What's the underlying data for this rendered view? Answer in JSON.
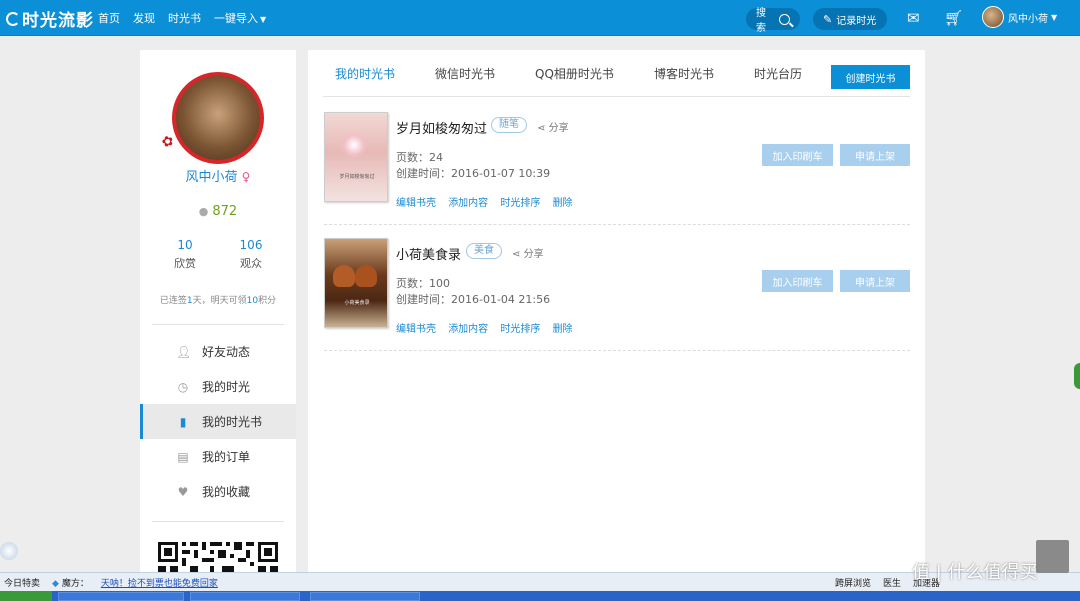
{
  "header": {
    "logo": "时光流影",
    "nav": [
      {
        "label": "首页"
      },
      {
        "label": "发现"
      },
      {
        "label": "时光书"
      },
      {
        "label": "一键导入"
      }
    ],
    "search_label": "搜索",
    "record_label": "记录时光",
    "username": "风中小荷"
  },
  "profile": {
    "name": "风中小荷",
    "points": "872",
    "appreciate_count": "10",
    "appreciate_label": "欣赏",
    "viewers_count": "106",
    "viewers_label": "观众",
    "signin_prefix": "已连签",
    "signin_days": "1",
    "signin_mid": "天，明天可领",
    "signin_points": "10",
    "signin_suffix": "积分"
  },
  "sidebar": {
    "items": [
      {
        "label": "好友动态",
        "icon": "user-icon"
      },
      {
        "label": "我的时光",
        "icon": "clock-icon"
      },
      {
        "label": "我的时光书",
        "icon": "book-icon"
      },
      {
        "label": "我的订单",
        "icon": "document-icon"
      },
      {
        "label": "我的收藏",
        "icon": "heart-icon"
      }
    ],
    "active_index": 2
  },
  "tabs": [
    {
      "label": "我的时光书"
    },
    {
      "label": "微信时光书"
    },
    {
      "label": "QQ相册时光书"
    },
    {
      "label": "博客时光书"
    },
    {
      "label": "时光台历"
    }
  ],
  "create_button": "创建时光书",
  "books": [
    {
      "title": "岁月如梭匆匆过",
      "tag": "随笔",
      "share": "分享",
      "pages": "页数：24",
      "created": "创建时间：2016-01-07 10:39",
      "cover_text": "岁月如梭匆匆过",
      "actions": [
        "编辑书壳",
        "添加内容",
        "时光排序",
        "删除"
      ],
      "print_button": "加入印刷车",
      "shelf_button": "申请上架"
    },
    {
      "title": "小荷美食录",
      "tag": "美食",
      "share": "分享",
      "pages": "页数：100",
      "created": "创建时间：2016-01-04 21:56",
      "cover_text": "小荷美食录",
      "actions": [
        "编辑书壳",
        "添加内容",
        "时光排序",
        "删除"
      ],
      "print_button": "加入印刷车",
      "shelf_button": "申请上架"
    }
  ],
  "statusbar": {
    "today": "今日特卖",
    "mofang": "魔方：",
    "link": "天呐！捡不到票也能免费回家",
    "right": [
      "跨屏浏览",
      "医生",
      "加速器"
    ]
  },
  "watermark": "值 | 什么值得买",
  "colors": {
    "header_bg": "#0b8fd6",
    "accent": "#1a8ad3",
    "disabled_button": "#a9cfee"
  }
}
